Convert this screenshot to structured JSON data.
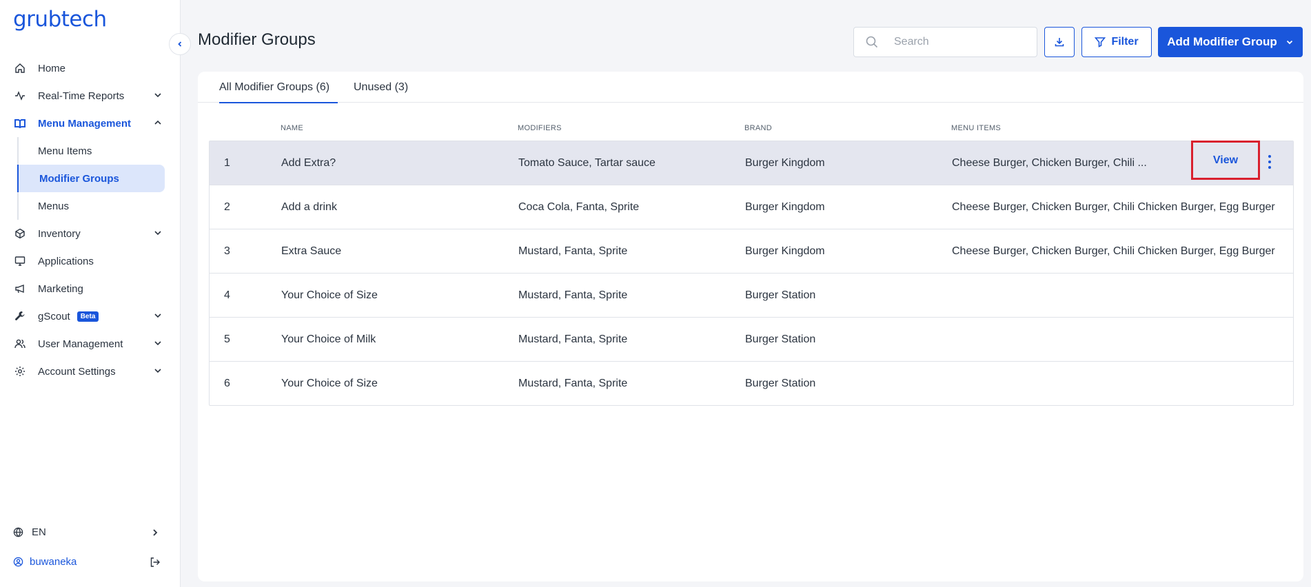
{
  "app": {
    "logo": "grubtech"
  },
  "sidebar": {
    "items": [
      {
        "label": "Home",
        "icon": "home-icon"
      },
      {
        "label": "Real-Time Reports",
        "icon": "activity-icon"
      },
      {
        "label": "Menu Management",
        "icon": "book-icon"
      },
      {
        "label": "Inventory",
        "icon": "box-icon"
      },
      {
        "label": "Applications",
        "icon": "monitor-icon"
      },
      {
        "label": "Marketing",
        "icon": "megaphone-icon"
      },
      {
        "label": "gScout",
        "icon": "wrench-icon",
        "badge": "Beta"
      },
      {
        "label": "User Management",
        "icon": "users-icon"
      },
      {
        "label": "Account Settings",
        "icon": "gear-icon"
      }
    ],
    "menu_management_sub": [
      "Menu Items",
      "Modifier Groups",
      "Menus"
    ],
    "language": "EN",
    "username": "buwaneka"
  },
  "header": {
    "title": "Modifier Groups",
    "search_placeholder": "Search",
    "filter_label": "Filter",
    "add_label": "Add Modifier Group"
  },
  "tabs": [
    {
      "label": "All Modifier Groups (6)"
    },
    {
      "label": "Unused (3)"
    }
  ],
  "table": {
    "columns": [
      "NAME",
      "MODIFIERS",
      "BRAND",
      "MENU ITEMS"
    ],
    "rows": [
      {
        "num": "1",
        "name": "Add Extra?",
        "modifiers": "Tomato Sauce, Tartar sauce",
        "brand": "Burger Kingdom",
        "menu_items": "Cheese Burger, Chicken Burger, Chili ..."
      },
      {
        "num": "2",
        "name": "Add a drink",
        "modifiers": "Coca Cola, Fanta, Sprite",
        "brand": "Burger Kingdom",
        "menu_items": "Cheese Burger, Chicken Burger, Chili Chicken Burger, Egg Burger"
      },
      {
        "num": "3",
        "name": "Extra Sauce",
        "modifiers": "Mustard, Fanta, Sprite",
        "brand": "Burger Kingdom",
        "menu_items": "Cheese Burger, Chicken Burger, Chili Chicken Burger, Egg Burger"
      },
      {
        "num": "4",
        "name": "Your Choice of Size",
        "modifiers": "Mustard, Fanta, Sprite",
        "brand": "Burger Station",
        "menu_items": ""
      },
      {
        "num": "5",
        "name": "Your Choice of Milk",
        "modifiers": "Mustard, Fanta, Sprite",
        "brand": "Burger Station",
        "menu_items": ""
      },
      {
        "num": "6",
        "name": "Your Choice of Size",
        "modifiers": "Mustard, Fanta, Sprite",
        "brand": "Burger Station",
        "menu_items": ""
      }
    ],
    "row_action_label": "View"
  },
  "colors": {
    "accent": "#1a56db",
    "highlight": "#d9202e"
  }
}
